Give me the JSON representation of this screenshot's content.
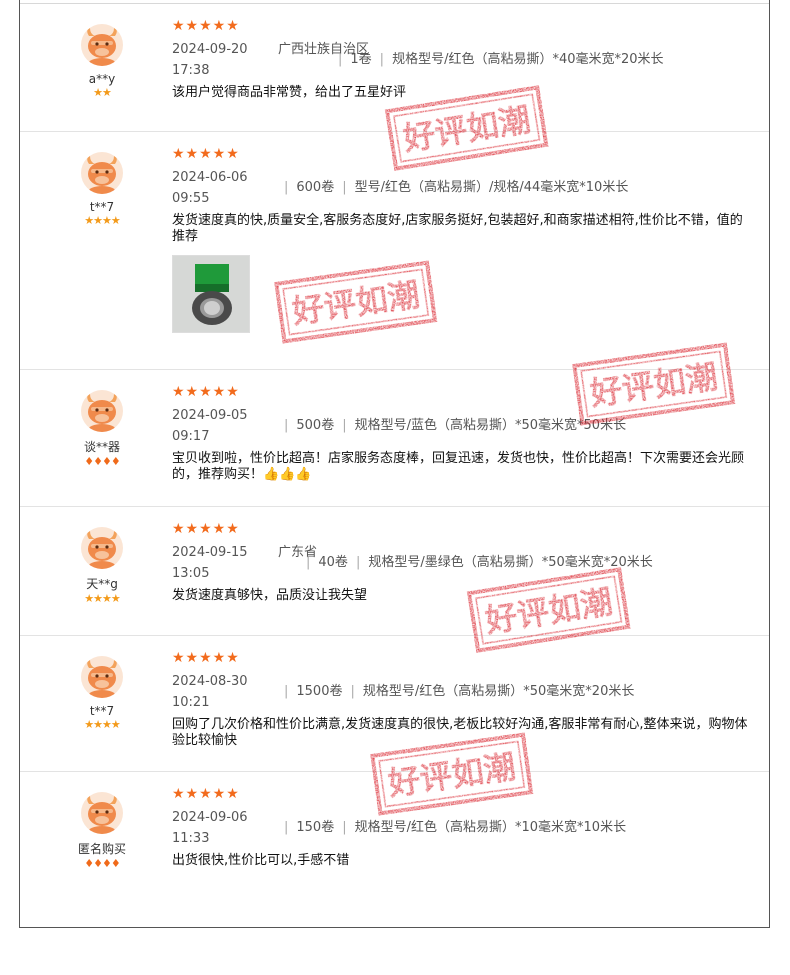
{
  "reviews": [
    {
      "nickname": "a**y",
      "level": "★★",
      "level_kind": "crown",
      "stars": "★★★★★",
      "date": "2024-09-20",
      "time": "17:38",
      "region": "广西壮族自治区",
      "quantity": "1卷",
      "spec": "规格型号/红色（高粘易撕）*40毫米宽*20米长",
      "comment": "该用户觉得商品非常赞，给出了五星好评"
    },
    {
      "nickname": "t**7",
      "level": "★★★★",
      "level_kind": "crown",
      "stars": "★★★★★",
      "date": "2024-06-06",
      "time": "09:55",
      "region": "",
      "quantity": "600卷",
      "spec": "型号/红色（高粘易撕）/规格/44毫米宽*10米长",
      "comment": "发货速度真的快,质量安全,客服务态度好,店家服务挺好,包装超好,和商家描述相符,性价比不错，值的推荐",
      "has_photo": true
    },
    {
      "nickname": "谈**器",
      "level": "♦♦♦♦",
      "level_kind": "gem",
      "stars": "★★★★★",
      "date": "2024-09-05",
      "time": "09:17",
      "region": "",
      "quantity": "500卷",
      "spec": "规格型号/蓝色（高粘易撕）*50毫米宽*50米长",
      "comment": "宝贝收到啦，性价比超高！店家服务态度棒，回复迅速，发货也快，性价比超高！下次需要还会光顾的，推荐购买！👍👍👍"
    },
    {
      "nickname": "天**g",
      "level": "★★★★",
      "level_kind": "crown",
      "stars": "★★★★★",
      "date": "2024-09-15",
      "time": "13:05",
      "region": "广东省",
      "quantity": "40卷",
      "spec": "规格型号/墨绿色（高粘易撕）*50毫米宽*20米长",
      "comment": "发货速度真够快，品质没让我失望"
    },
    {
      "nickname": "t**7",
      "level": "★★★★",
      "level_kind": "crown",
      "stars": "★★★★★",
      "date": "2024-08-30",
      "time": "10:21",
      "region": "",
      "quantity": "1500卷",
      "spec": "规格型号/红色（高粘易撕）*50毫米宽*20米长",
      "comment": "回购了几次价格和性价比满意,发货速度真的很快,老板比较好沟通,客服非常有耐心,整体来说，购物体验比较愉快"
    },
    {
      "nickname": "匿名购买",
      "level": "♦♦♦♦",
      "level_kind": "gem",
      "stars": "★★★★★",
      "date": "2024-09-06",
      "time": "11:33",
      "region": "",
      "quantity": "150卷",
      "spec": "规格型号/红色（高粘易撕）*10毫米宽*10米长",
      "comment": "出货很快,性价比可以,手感不错"
    }
  ],
  "stamp_text": "好评如潮",
  "colors": {
    "stamp": "#d9212b",
    "stars": "#f26b1d",
    "avatar": "#f08a4b"
  },
  "icons": {
    "avatar": "bull-mascot-icon",
    "level": "crown-icon"
  }
}
